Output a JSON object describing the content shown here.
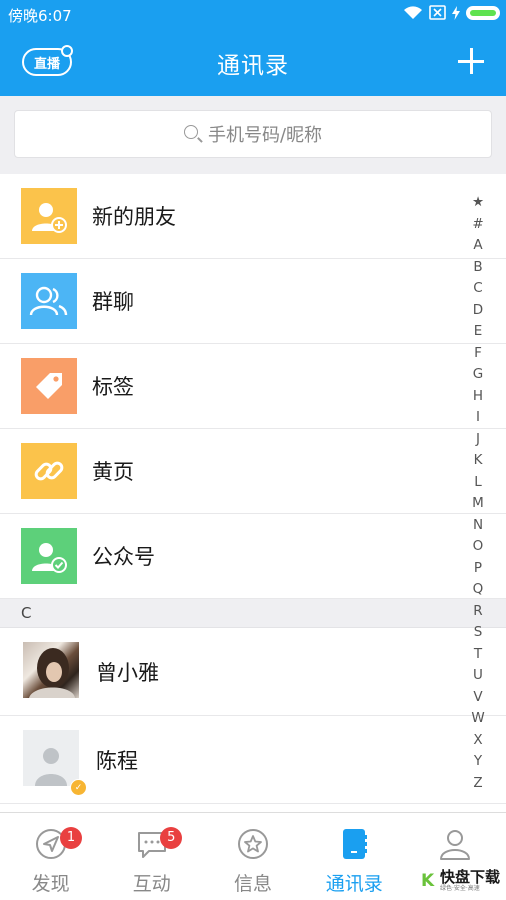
{
  "status_bar": {
    "time": "傍晚6:07"
  },
  "header": {
    "live_label": "直播",
    "title": "通讯录"
  },
  "search": {
    "placeholder": "手机号码/昵称"
  },
  "function_items": [
    {
      "label": "新的朋友",
      "icon": "add-friend-icon",
      "color": "#fbc34b"
    },
    {
      "label": "群聊",
      "icon": "group-chat-icon",
      "color": "#4cb5f5"
    },
    {
      "label": "标签",
      "icon": "tag-icon",
      "color": "#f99e68"
    },
    {
      "label": "黄页",
      "icon": "link-icon",
      "color": "#fbc34b"
    },
    {
      "label": "公众号",
      "icon": "official-account-icon",
      "color": "#5dd07a"
    }
  ],
  "sections": [
    {
      "letter": "C",
      "contacts": [
        {
          "name": "曾小雅"
        },
        {
          "name": "陈程"
        }
      ]
    }
  ],
  "index_letters": [
    "★",
    "#",
    "A",
    "B",
    "C",
    "D",
    "E",
    "F",
    "G",
    "H",
    "I",
    "J",
    "K",
    "L",
    "M",
    "N",
    "O",
    "P",
    "Q",
    "R",
    "S",
    "T",
    "U",
    "V",
    "W",
    "X",
    "Y",
    "Z"
  ],
  "tabs": [
    {
      "label": "发现",
      "badge": "1",
      "icon": "discover-icon"
    },
    {
      "label": "互动",
      "badge": "5",
      "icon": "chat-bubble-icon"
    },
    {
      "label": "信息",
      "badge": "",
      "icon": "star-circle-icon"
    },
    {
      "label": "通讯录",
      "badge": "",
      "icon": "contacts-book-icon",
      "active": true
    },
    {
      "label": "",
      "badge": "",
      "icon": "profile-icon"
    }
  ],
  "watermark": {
    "brand": "快盘下载",
    "slogan": "绿色·安全·高速"
  },
  "colors": {
    "primary": "#1a9ff0",
    "badge": "#e94040",
    "tab_inactive": "#888888"
  }
}
